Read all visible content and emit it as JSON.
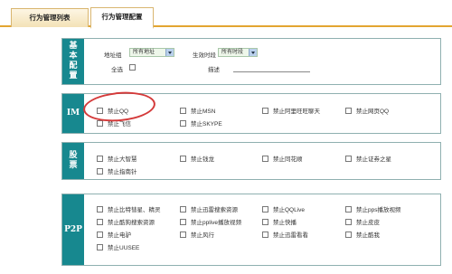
{
  "tabs": [
    {
      "label": "行为管理列表",
      "active": false
    },
    {
      "label": "行为管理配置",
      "active": true
    }
  ],
  "basic": {
    "label": "基本配置",
    "address_group_label": "地址组",
    "address_group_value": "所有地址",
    "time_label": "生效时段",
    "time_value": "所有时段",
    "select_all_label": "全选",
    "description_label": "描述",
    "description_value": ""
  },
  "im": {
    "label": "IM",
    "items": [
      "禁止QQ",
      "禁止MSN",
      "禁止阿里旺旺聊天",
      "禁止网页QQ",
      "禁止飞信",
      "禁止SKYPE"
    ]
  },
  "stock": {
    "label": "股票",
    "items": [
      "禁止大智慧",
      "禁止钱龙",
      "禁止同花顺",
      "禁止证券之星",
      "禁止指南针"
    ]
  },
  "p2p": {
    "label": "P2P",
    "items": [
      "禁止比特彗星、精灵",
      "禁止迅雷搜索资源",
      "禁止QQLive",
      "禁止pps播放视频",
      "禁止酷狗搜索资源",
      "禁止pplive播放视频",
      "禁止快播",
      "禁止皮皮",
      "禁止电驴",
      "禁止风行",
      "禁止迅雷看看",
      "禁止酷我",
      "禁止UUSEE"
    ]
  },
  "colors": {
    "section_label_bg": "#17888f",
    "tab_accent": "#e3a531",
    "highlight_circle": "#d43a3a"
  }
}
